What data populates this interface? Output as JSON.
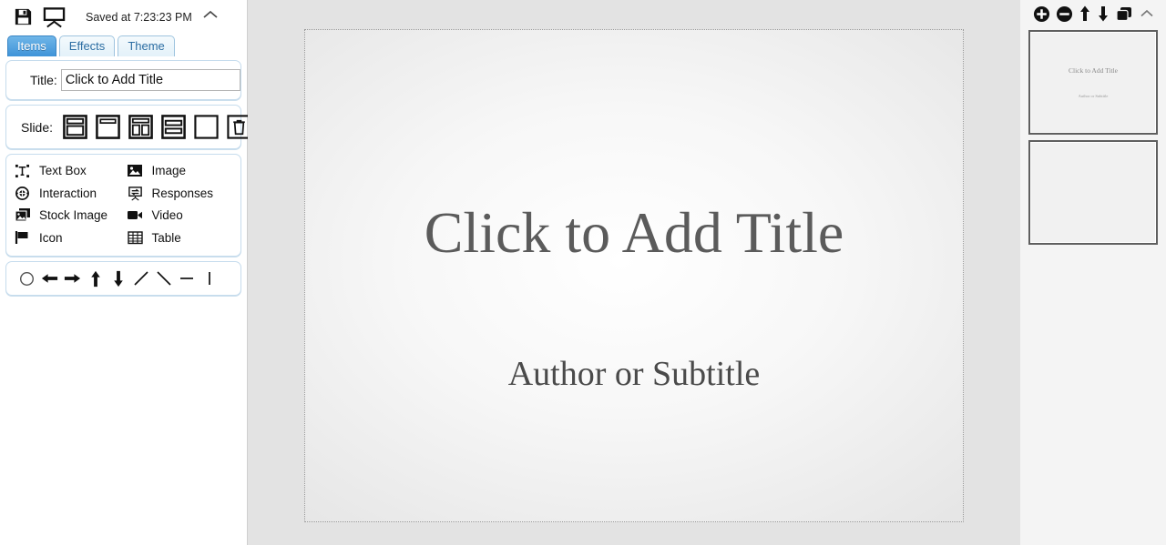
{
  "topbar": {
    "save_icon": "floppy-disk-save-icon",
    "present_icon": "presentation-screen-icon",
    "status": "Saved at 7:23:23 PM",
    "collapse_icon": "chevron-up-icon"
  },
  "tabs": [
    {
      "label": "Items",
      "active": true
    },
    {
      "label": "Effects",
      "active": false
    },
    {
      "label": "Theme",
      "active": false
    }
  ],
  "title_row": {
    "label": "Title:",
    "value": "Click to Add Title",
    "placeholder": "Click to Add Title"
  },
  "slide_row": {
    "label": "Slide:",
    "layouts": [
      {
        "name": "layout-title-content",
        "title": "Title and Content"
      },
      {
        "name": "layout-title-only",
        "title": "Title Only"
      },
      {
        "name": "layout-two-content",
        "title": "Two Content"
      },
      {
        "name": "layout-stacked-bands",
        "title": "Stacked Sections"
      },
      {
        "name": "layout-blank",
        "title": "Blank"
      },
      {
        "name": "layout-delete-slide",
        "title": "Delete Slide"
      }
    ]
  },
  "items": [
    {
      "label": "Text Box",
      "icon": "text-box-icon"
    },
    {
      "label": "Image",
      "icon": "image-icon"
    },
    {
      "label": "Interaction",
      "icon": "interaction-icon"
    },
    {
      "label": "Responses",
      "icon": "responses-icon"
    },
    {
      "label": "Stock Image",
      "icon": "stock-image-icon"
    },
    {
      "label": "Video",
      "icon": "video-camera-icon"
    },
    {
      "label": "Icon",
      "icon": "flag-icon"
    },
    {
      "label": "Table",
      "icon": "table-grid-icon"
    }
  ],
  "shapes": [
    {
      "name": "circle-shape",
      "title": "Circle"
    },
    {
      "name": "arrow-left-shape",
      "title": "Left Arrow"
    },
    {
      "name": "arrow-right-shape",
      "title": "Right Arrow"
    },
    {
      "name": "arrow-up-shape",
      "title": "Up Arrow"
    },
    {
      "name": "arrow-down-shape",
      "title": "Down Arrow"
    },
    {
      "name": "line-diagonal-up-shape",
      "title": "Diagonal Line Up"
    },
    {
      "name": "line-diagonal-down-shape",
      "title": "Diagonal Line Down"
    },
    {
      "name": "line-horizontal-shape",
      "title": "Horizontal Line"
    },
    {
      "name": "line-vertical-shape",
      "title": "Vertical Line"
    }
  ],
  "canvas": {
    "title": "Click to Add Title",
    "subtitle": "Author or Subtitle"
  },
  "slides_panel": {
    "toolbar": [
      {
        "name": "add-slide-icon",
        "title": "Add Slide"
      },
      {
        "name": "remove-slide-icon",
        "title": "Remove Slide"
      },
      {
        "name": "move-slide-up-icon",
        "title": "Move Up"
      },
      {
        "name": "move-slide-down-icon",
        "title": "Move Down"
      },
      {
        "name": "duplicate-slide-icon",
        "title": "Duplicate Slide"
      },
      {
        "name": "collapse-panel-icon",
        "title": "Collapse"
      }
    ],
    "thumbnails": [
      {
        "title": "Click to Add Title",
        "subtitle": "Author or Subtitle",
        "selected": true
      },
      {
        "title": "",
        "subtitle": "",
        "selected": false
      }
    ]
  },
  "colors": {
    "tab_active_start": "#6fb6e8",
    "tab_active_end": "#3f93d8",
    "panel_border": "#c6dced",
    "workspace_bg": "#e3e3e3",
    "slides_bg": "#f4f4f4",
    "canvas_text": "#5b5b5b"
  }
}
